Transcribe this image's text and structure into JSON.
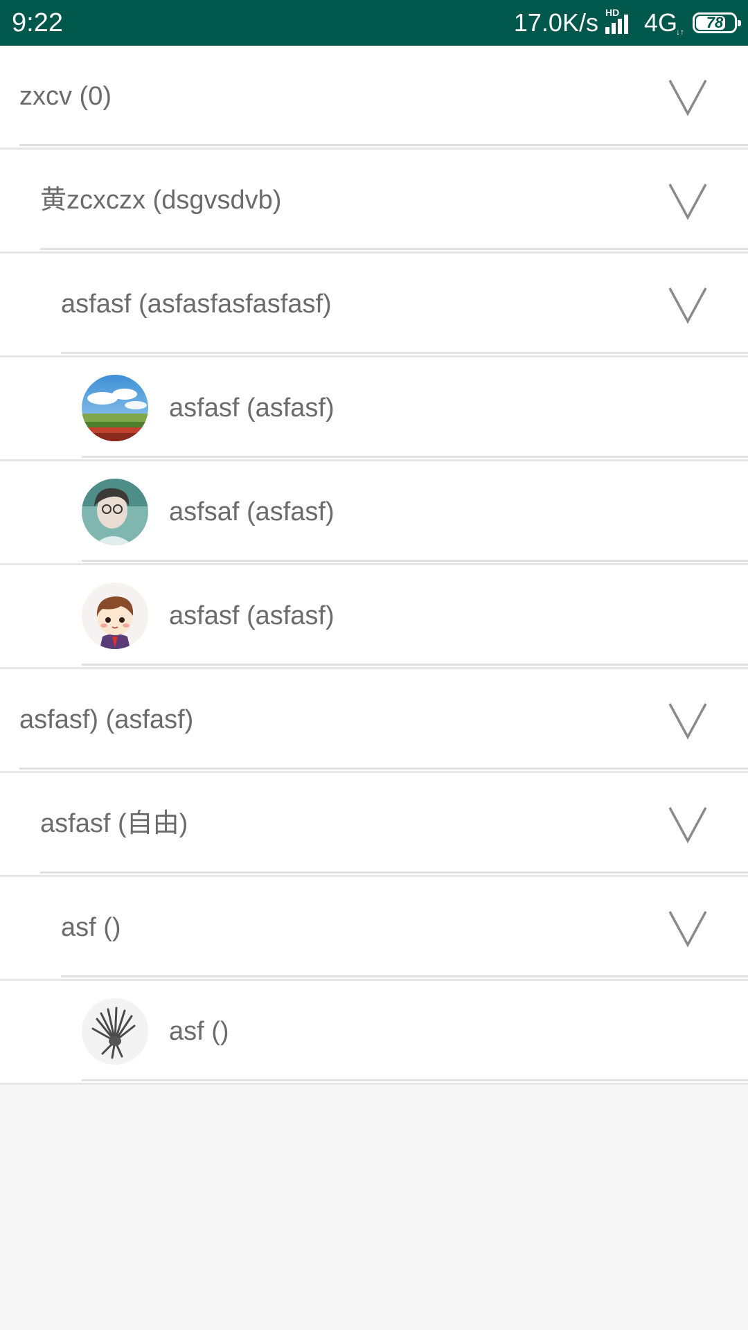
{
  "status_bar": {
    "time": "9:22",
    "net_speed": "17.0K/s",
    "hd_label": "HD",
    "network_type": "4G",
    "network_arrows": "↓↑",
    "battery_level": "78",
    "battery_fraction": 0.78,
    "background_color": "#00574b"
  },
  "rows": [
    {
      "label": "zxcv (0)",
      "depth": 0,
      "kind": "group",
      "icon": "chevron-down-icon"
    },
    {
      "label": "黄zcxczx (dsgvsdvb)",
      "depth": 1,
      "kind": "group",
      "icon": "chevron-down-icon"
    },
    {
      "label": "asfasf (asfasfasfasfasf)",
      "depth": 2,
      "kind": "group",
      "icon": "chevron-down-icon"
    },
    {
      "label": "asfasf (asfasf)",
      "depth": 3,
      "kind": "member",
      "avatar": "landscape-avatar"
    },
    {
      "label": "asfsaf (asfasf)",
      "depth": 3,
      "kind": "member",
      "avatar": "girl-portrait-avatar"
    },
    {
      "label": "asfasf (asfasf)",
      "depth": 3,
      "kind": "member",
      "avatar": "cartoon-boy-avatar"
    },
    {
      "label": "asfasf) (asfasf)",
      "depth": 0,
      "kind": "group",
      "icon": "chevron-down-icon"
    },
    {
      "label": "asfasf (自由)",
      "depth": 1,
      "kind": "group",
      "icon": "chevron-down-icon"
    },
    {
      "label": "asf ()",
      "depth": 2,
      "kind": "group",
      "icon": "chevron-down-icon"
    },
    {
      "label": "asf ()",
      "depth": 3,
      "kind": "member",
      "avatar": "feather-headdress-avatar"
    }
  ]
}
